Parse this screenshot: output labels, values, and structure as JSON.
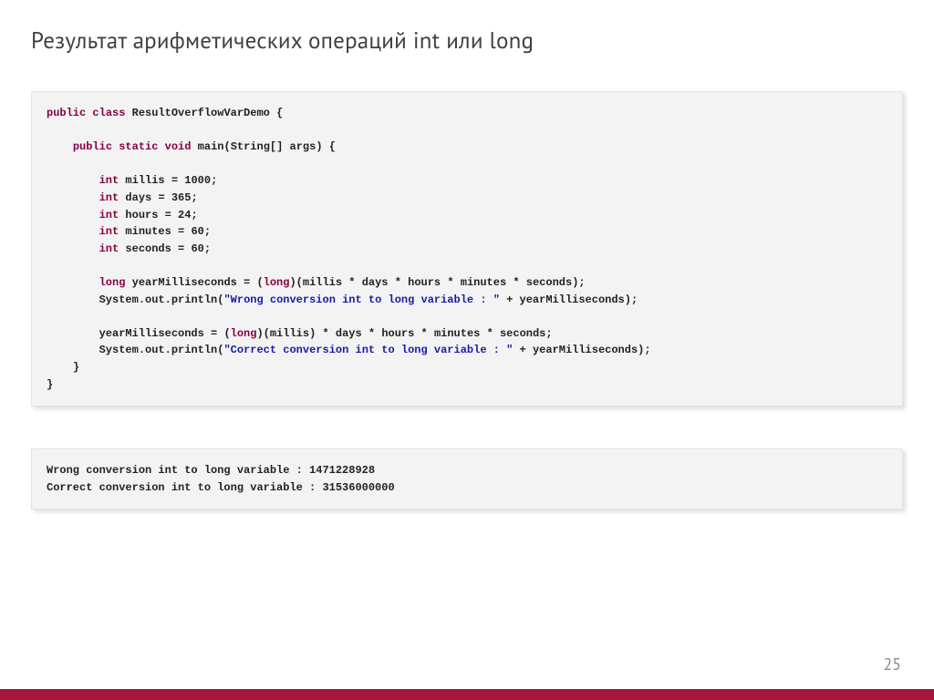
{
  "title": "Результат арифметических операций int или long",
  "page_number": "25",
  "code": {
    "lines": [
      [
        {
          "t": "kw",
          "v": "public"
        },
        {
          "t": "sp",
          "v": " "
        },
        {
          "t": "kw",
          "v": "class"
        },
        {
          "t": "sp",
          "v": " "
        },
        {
          "t": "id",
          "v": "ResultOverflowVarDemo"
        },
        {
          "t": "sp",
          "v": " "
        },
        {
          "t": "punc",
          "v": "{"
        }
      ],
      [],
      [
        {
          "t": "sp",
          "v": "    "
        },
        {
          "t": "kw",
          "v": "public"
        },
        {
          "t": "sp",
          "v": " "
        },
        {
          "t": "kw",
          "v": "static"
        },
        {
          "t": "sp",
          "v": " "
        },
        {
          "t": "type",
          "v": "void"
        },
        {
          "t": "sp",
          "v": " "
        },
        {
          "t": "id",
          "v": "main"
        },
        {
          "t": "punc",
          "v": "("
        },
        {
          "t": "id",
          "v": "String"
        },
        {
          "t": "punc",
          "v": "[]"
        },
        {
          "t": "sp",
          "v": " "
        },
        {
          "t": "id",
          "v": "args"
        },
        {
          "t": "punc",
          "v": ")"
        },
        {
          "t": "sp",
          "v": " "
        },
        {
          "t": "punc",
          "v": "{"
        }
      ],
      [],
      [
        {
          "t": "sp",
          "v": "        "
        },
        {
          "t": "type",
          "v": "int"
        },
        {
          "t": "sp",
          "v": " "
        },
        {
          "t": "id",
          "v": "millis"
        },
        {
          "t": "sp",
          "v": " "
        },
        {
          "t": "punc",
          "v": "="
        },
        {
          "t": "sp",
          "v": " "
        },
        {
          "t": "num",
          "v": "1000"
        },
        {
          "t": "punc",
          "v": ";"
        }
      ],
      [
        {
          "t": "sp",
          "v": "        "
        },
        {
          "t": "type",
          "v": "int"
        },
        {
          "t": "sp",
          "v": " "
        },
        {
          "t": "id",
          "v": "days"
        },
        {
          "t": "sp",
          "v": " "
        },
        {
          "t": "punc",
          "v": "="
        },
        {
          "t": "sp",
          "v": " "
        },
        {
          "t": "num",
          "v": "365"
        },
        {
          "t": "punc",
          "v": ";"
        }
      ],
      [
        {
          "t": "sp",
          "v": "        "
        },
        {
          "t": "type",
          "v": "int"
        },
        {
          "t": "sp",
          "v": " "
        },
        {
          "t": "id",
          "v": "hours"
        },
        {
          "t": "sp",
          "v": " "
        },
        {
          "t": "punc",
          "v": "="
        },
        {
          "t": "sp",
          "v": " "
        },
        {
          "t": "num",
          "v": "24"
        },
        {
          "t": "punc",
          "v": ";"
        }
      ],
      [
        {
          "t": "sp",
          "v": "        "
        },
        {
          "t": "type",
          "v": "int"
        },
        {
          "t": "sp",
          "v": " "
        },
        {
          "t": "id",
          "v": "minutes"
        },
        {
          "t": "sp",
          "v": " "
        },
        {
          "t": "punc",
          "v": "="
        },
        {
          "t": "sp",
          "v": " "
        },
        {
          "t": "num",
          "v": "60"
        },
        {
          "t": "punc",
          "v": ";"
        }
      ],
      [
        {
          "t": "sp",
          "v": "        "
        },
        {
          "t": "type",
          "v": "int"
        },
        {
          "t": "sp",
          "v": " "
        },
        {
          "t": "id",
          "v": "seconds"
        },
        {
          "t": "sp",
          "v": " "
        },
        {
          "t": "punc",
          "v": "="
        },
        {
          "t": "sp",
          "v": " "
        },
        {
          "t": "num",
          "v": "60"
        },
        {
          "t": "punc",
          "v": ";"
        }
      ],
      [],
      [
        {
          "t": "sp",
          "v": "        "
        },
        {
          "t": "type",
          "v": "long"
        },
        {
          "t": "sp",
          "v": " "
        },
        {
          "t": "id",
          "v": "yearMilliseconds"
        },
        {
          "t": "sp",
          "v": " "
        },
        {
          "t": "punc",
          "v": "="
        },
        {
          "t": "sp",
          "v": " "
        },
        {
          "t": "punc",
          "v": "("
        },
        {
          "t": "type",
          "v": "long"
        },
        {
          "t": "punc",
          "v": ")("
        },
        {
          "t": "id",
          "v": "millis"
        },
        {
          "t": "sp",
          "v": " "
        },
        {
          "t": "punc",
          "v": "*"
        },
        {
          "t": "sp",
          "v": " "
        },
        {
          "t": "id",
          "v": "days"
        },
        {
          "t": "sp",
          "v": " "
        },
        {
          "t": "punc",
          "v": "*"
        },
        {
          "t": "sp",
          "v": " "
        },
        {
          "t": "id",
          "v": "hours"
        },
        {
          "t": "sp",
          "v": " "
        },
        {
          "t": "punc",
          "v": "*"
        },
        {
          "t": "sp",
          "v": " "
        },
        {
          "t": "id",
          "v": "minutes"
        },
        {
          "t": "sp",
          "v": " "
        },
        {
          "t": "punc",
          "v": "*"
        },
        {
          "t": "sp",
          "v": " "
        },
        {
          "t": "id",
          "v": "seconds"
        },
        {
          "t": "punc",
          "v": ");"
        }
      ],
      [
        {
          "t": "sp",
          "v": "        "
        },
        {
          "t": "id",
          "v": "System"
        },
        {
          "t": "punc",
          "v": "."
        },
        {
          "t": "id",
          "v": "out"
        },
        {
          "t": "punc",
          "v": "."
        },
        {
          "t": "id",
          "v": "println"
        },
        {
          "t": "punc",
          "v": "("
        },
        {
          "t": "str",
          "v": "\"Wrong conversion int to long variable : \""
        },
        {
          "t": "sp",
          "v": " "
        },
        {
          "t": "punc",
          "v": "+"
        },
        {
          "t": "sp",
          "v": " "
        },
        {
          "t": "id",
          "v": "yearMilliseconds"
        },
        {
          "t": "punc",
          "v": ");"
        }
      ],
      [],
      [
        {
          "t": "sp",
          "v": "        "
        },
        {
          "t": "id",
          "v": "yearMilliseconds"
        },
        {
          "t": "sp",
          "v": " "
        },
        {
          "t": "punc",
          "v": "="
        },
        {
          "t": "sp",
          "v": " "
        },
        {
          "t": "punc",
          "v": "("
        },
        {
          "t": "type",
          "v": "long"
        },
        {
          "t": "punc",
          "v": ")("
        },
        {
          "t": "id",
          "v": "millis"
        },
        {
          "t": "punc",
          "v": ")"
        },
        {
          "t": "sp",
          "v": " "
        },
        {
          "t": "punc",
          "v": "*"
        },
        {
          "t": "sp",
          "v": " "
        },
        {
          "t": "id",
          "v": "days"
        },
        {
          "t": "sp",
          "v": " "
        },
        {
          "t": "punc",
          "v": "*"
        },
        {
          "t": "sp",
          "v": " "
        },
        {
          "t": "id",
          "v": "hours"
        },
        {
          "t": "sp",
          "v": " "
        },
        {
          "t": "punc",
          "v": "*"
        },
        {
          "t": "sp",
          "v": " "
        },
        {
          "t": "id",
          "v": "minutes"
        },
        {
          "t": "sp",
          "v": " "
        },
        {
          "t": "punc",
          "v": "*"
        },
        {
          "t": "sp",
          "v": " "
        },
        {
          "t": "id",
          "v": "seconds"
        },
        {
          "t": "punc",
          "v": ";"
        }
      ],
      [
        {
          "t": "sp",
          "v": "        "
        },
        {
          "t": "id",
          "v": "System"
        },
        {
          "t": "punc",
          "v": "."
        },
        {
          "t": "id",
          "v": "out"
        },
        {
          "t": "punc",
          "v": "."
        },
        {
          "t": "id",
          "v": "println"
        },
        {
          "t": "punc",
          "v": "("
        },
        {
          "t": "str",
          "v": "\"Correct conversion int to long variable : \""
        },
        {
          "t": "sp",
          "v": " "
        },
        {
          "t": "punc",
          "v": "+"
        },
        {
          "t": "sp",
          "v": " "
        },
        {
          "t": "id",
          "v": "yearMilliseconds"
        },
        {
          "t": "punc",
          "v": ");"
        }
      ],
      [
        {
          "t": "sp",
          "v": "    "
        },
        {
          "t": "punc",
          "v": "}"
        }
      ],
      [
        {
          "t": "punc",
          "v": "}"
        }
      ]
    ]
  },
  "output_lines": [
    "Wrong conversion int to long variable : 1471228928",
    "Correct conversion int to long variable : 31536000000"
  ]
}
